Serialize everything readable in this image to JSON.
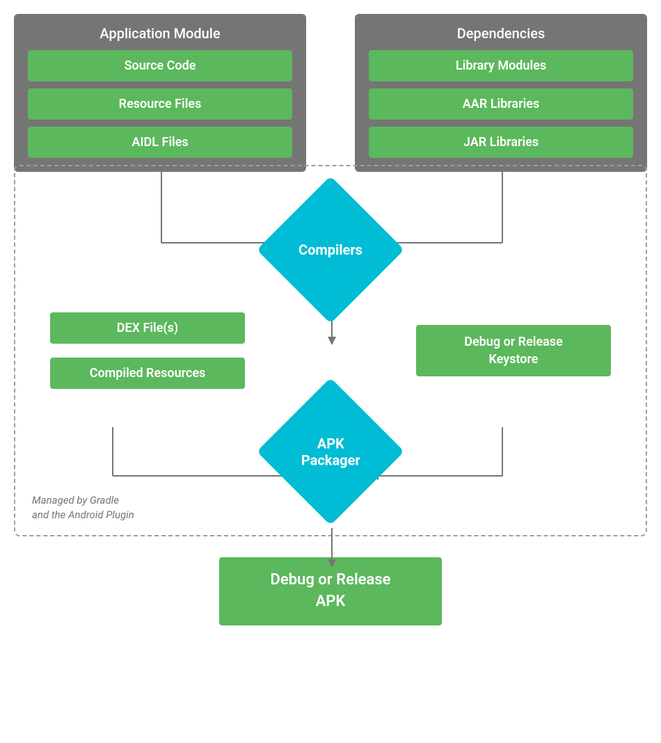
{
  "diagram": {
    "app_module": {
      "title": "Application Module",
      "items": [
        "Source Code",
        "Resource Files",
        "AIDL Files"
      ]
    },
    "dependencies": {
      "title": "Dependencies",
      "items": [
        "Library Modules",
        "AAR Libraries",
        "JAR Libraries"
      ]
    },
    "compilers": {
      "label": "Compilers"
    },
    "dex_files": {
      "label": "DEX File(s)"
    },
    "compiled_resources": {
      "label": "Compiled Resources"
    },
    "keystore": {
      "label": "Debug or Release\nKeystore"
    },
    "apk_packager": {
      "label": "APK\nPackager"
    },
    "final_apk": {
      "label": "Debug or Release\nAPK"
    },
    "gradle_label": {
      "line1": "Managed by Gradle",
      "line2": "and the Android Plugin"
    }
  }
}
